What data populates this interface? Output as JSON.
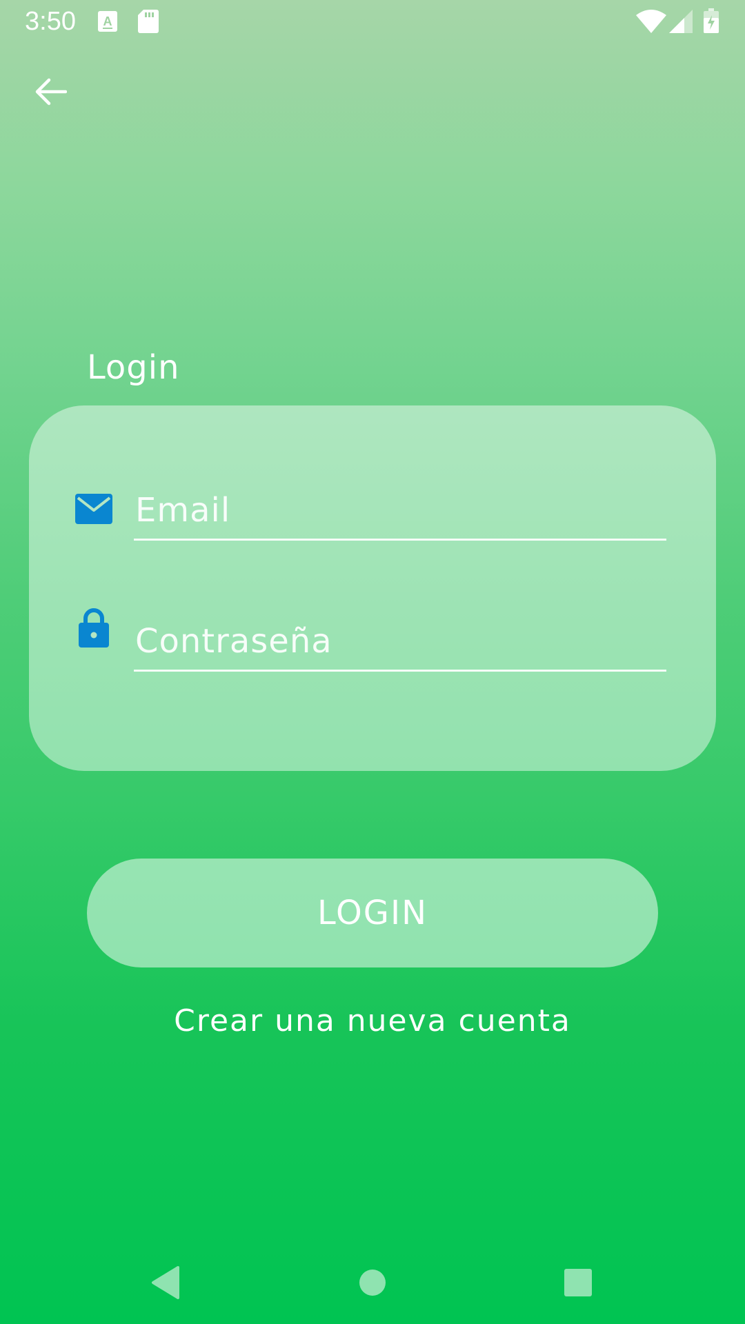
{
  "status_bar": {
    "time": "3:50",
    "icons": [
      "keyboard-a-icon",
      "sd-card-icon",
      "wifi-icon",
      "signal-icon",
      "battery-charging-icon"
    ]
  },
  "header": {
    "back_icon": "arrow-back-icon"
  },
  "login": {
    "title": "Login",
    "email": {
      "icon": "envelope-icon",
      "placeholder": "Email",
      "value": ""
    },
    "password": {
      "icon": "lock-icon",
      "placeholder": "Contraseña",
      "value": ""
    },
    "submit_label": "LOGIN",
    "create_account_label": "Crear una nueva cuenta"
  },
  "nav_bar": {
    "back_icon": "nav-back-icon",
    "home_icon": "nav-home-icon",
    "recents_icon": "nav-recents-icon"
  },
  "colors": {
    "icon_blue": "#0a86d0",
    "gradient_top": "#a6d6a8",
    "gradient_bottom": "#00c452"
  }
}
